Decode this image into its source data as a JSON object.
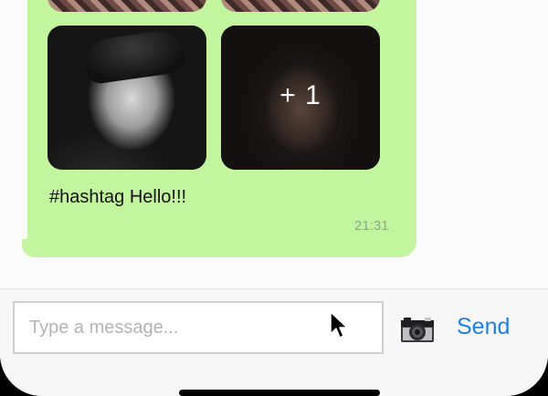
{
  "message": {
    "text": "#hashtag Hello!!!",
    "time": "21:31",
    "extra_photos_label": "+ 1",
    "photos": [
      "man-portrait",
      "woman-headscarf-portrait"
    ]
  },
  "composer": {
    "placeholder": "Type a message...",
    "value": "",
    "camera_icon": "camera-icon",
    "send_label": "Send"
  },
  "colors": {
    "bubble": "#c3f59e",
    "accent": "#1a80e6",
    "time_text": "#8fa48a",
    "background": "#fbfbfc"
  }
}
